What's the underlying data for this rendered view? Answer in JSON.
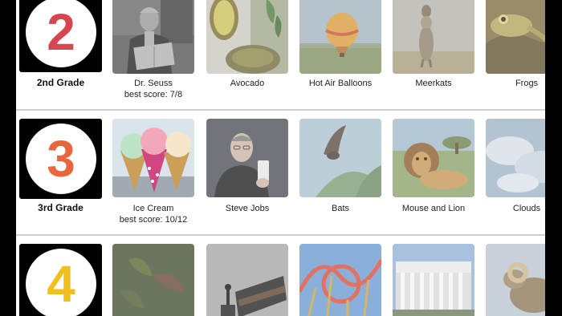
{
  "grades": [
    {
      "number": "2",
      "color": "#d64550",
      "label": "2nd Grade",
      "lessons": [
        {
          "title": "Dr. Seuss",
          "score": "best score: 7/8",
          "image": "photo-of-author-reading"
        },
        {
          "title": "Avocado",
          "score": "",
          "image": "avocado-photo"
        },
        {
          "title": "Hot Air Balloons",
          "score": "",
          "image": "hot-air-balloon-photo"
        },
        {
          "title": "Meerkats",
          "score": "",
          "image": "meerkat-photo"
        },
        {
          "title": "Frogs",
          "score": "",
          "image": "frog-photo"
        }
      ]
    },
    {
      "number": "3",
      "color": "#e8663c",
      "label": "3rd Grade",
      "lessons": [
        {
          "title": "Ice Cream",
          "score": "best score: 10/12",
          "image": "ice-cream-photo"
        },
        {
          "title": "Steve Jobs",
          "score": "",
          "image": "steve-jobs-photo"
        },
        {
          "title": "Bats",
          "score": "",
          "image": "bat-photo"
        },
        {
          "title": "Mouse and Lion",
          "score": "",
          "image": "lion-photo"
        },
        {
          "title": "Clouds",
          "score": "",
          "image": "clouds-photo"
        }
      ]
    },
    {
      "number": "4",
      "color": "#f2c01e",
      "label": "",
      "lessons": [
        {
          "title": "",
          "score": "",
          "image": "venus-flytrap-photo"
        },
        {
          "title": "",
          "score": "",
          "image": "game-console-photo"
        },
        {
          "title": "",
          "score": "",
          "image": "roller-coaster-photo"
        },
        {
          "title": "",
          "score": "",
          "image": "memorial-building-photo"
        },
        {
          "title": "",
          "score": "",
          "image": "bighorn-ram-photo"
        }
      ]
    }
  ]
}
